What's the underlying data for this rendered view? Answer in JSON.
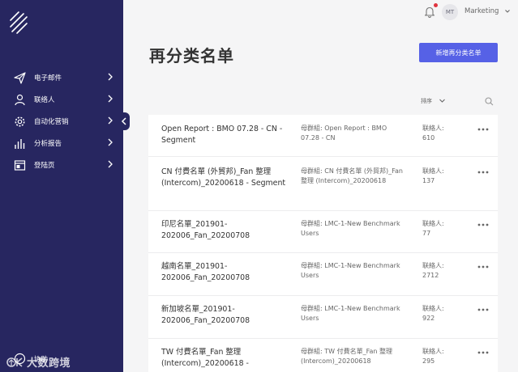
{
  "sidebar": {
    "items": [
      {
        "label": "电子邮件",
        "icon": "send-icon"
      },
      {
        "label": "联络人",
        "icon": "user-icon"
      },
      {
        "label": "自动化营销",
        "icon": "gear-icon"
      },
      {
        "label": "分析报告",
        "icon": "bar-chart-icon"
      },
      {
        "label": "登陆页",
        "icon": "landing-page-icon"
      }
    ],
    "help_label": "协助",
    "watermark": "大数跨境"
  },
  "topbar": {
    "avatar_initials": "MT",
    "workspace": "Marketing"
  },
  "header": {
    "title": "再分类名单",
    "new_button": "新增再分类名单"
  },
  "toolbar": {
    "sort_label": "排序"
  },
  "list": {
    "rows": [
      {
        "name": "Open Report : BMO 07.28 - CN - Segment",
        "parent": "母群組: Open Report : BMO 07.28 - CN",
        "count_label": "联絡人:",
        "count": "610"
      },
      {
        "name": "CN 付費名單 (外貿邦)_Fan 整理 (Intercom)_20200618 - Segment",
        "parent": "母群組: CN 付費名單 (外貿邦)_Fan 整理 (Intercom)_20200618",
        "count_label": "联絡人:",
        "count": "137"
      },
      {
        "name": "印尼名單_201901-202006_Fan_20200708",
        "parent": "母群組: LMC-1-New Benchmark Users",
        "count_label": "联絡人:",
        "count": "77"
      },
      {
        "name": "越南名單_201901-202006_Fan_20200708",
        "parent": "母群組: LMC-1-New Benchmark Users",
        "count_label": "联絡人:",
        "count": "2712"
      },
      {
        "name": "新加坡名單_201901-202006_Fan_20200708",
        "parent": "母群組: LMC-1-New Benchmark Users",
        "count_label": "联絡人:",
        "count": "922"
      },
      {
        "name": "TW 付費名單_Fan 整理 (Intercom)_20200618 -",
        "parent": "母群組: TW 付費名單_Fan 整理 (Intercom)_20200618",
        "count_label": "联絡人:",
        "count": "295"
      }
    ]
  },
  "colors": {
    "sidebar_bg": "#272660",
    "accent": "#5661e6",
    "notification": "#e0343f"
  }
}
